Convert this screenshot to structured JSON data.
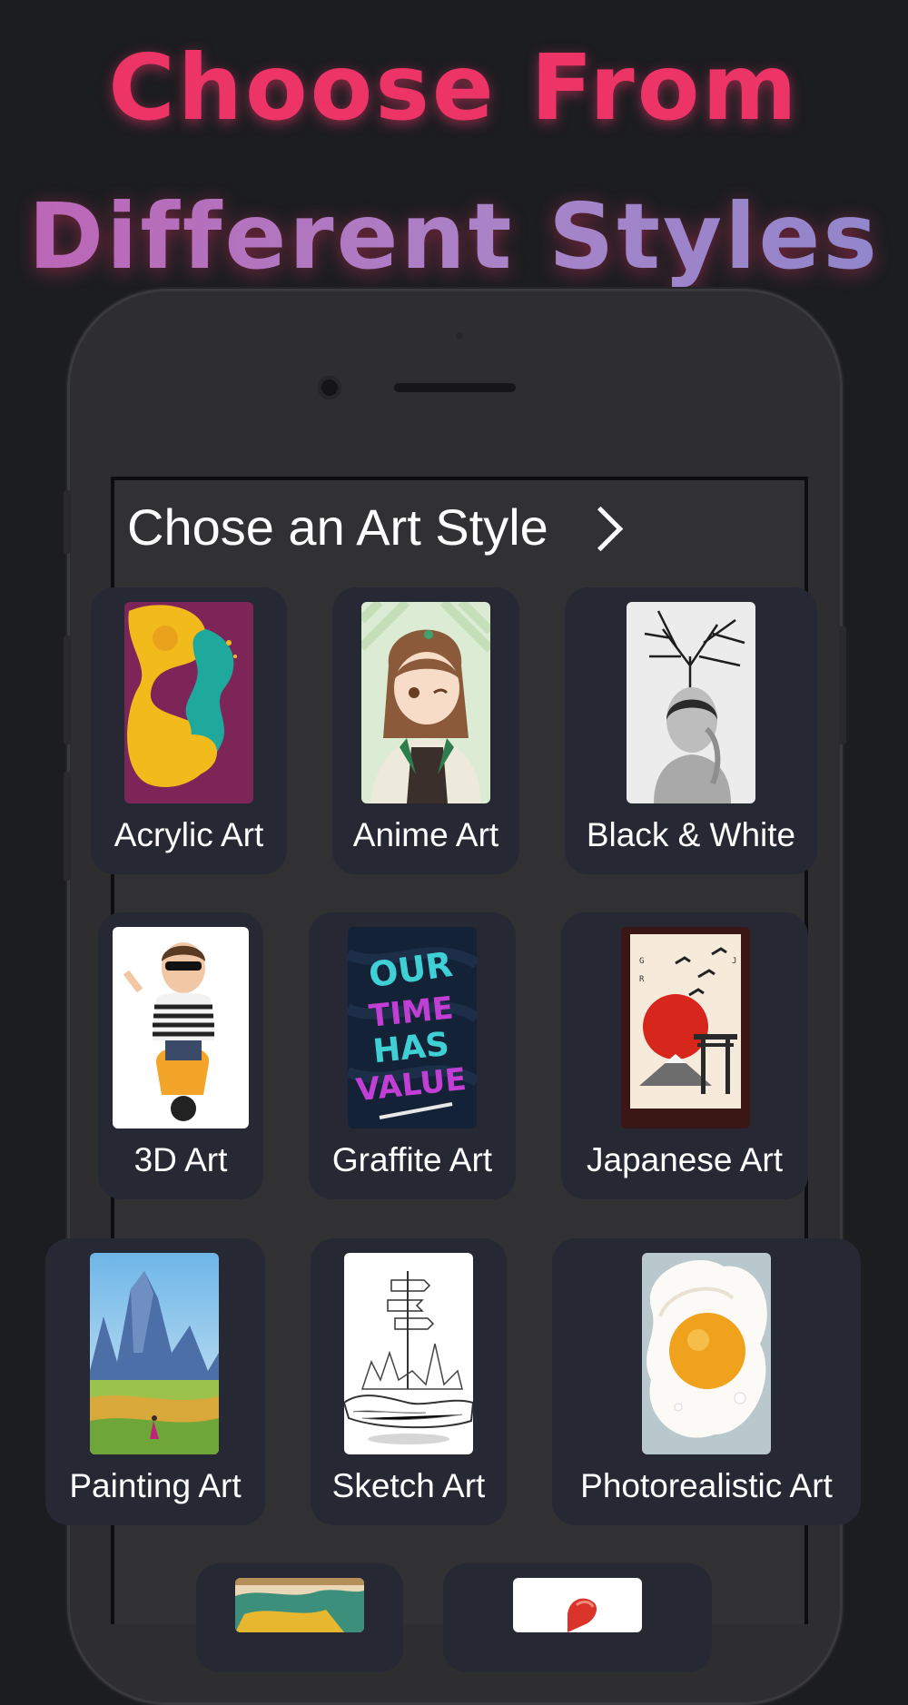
{
  "headline": {
    "line1": "Choose From",
    "line2": "Different Styles"
  },
  "screen": {
    "title": "Chose an Art Style",
    "chevron_icon": "chevron-right-icon"
  },
  "styles": [
    {
      "label": "Acrylic Art"
    },
    {
      "label": "Anime Art"
    },
    {
      "label": "Black & White"
    },
    {
      "label": "3D Art"
    },
    {
      "label": "Graffite Art"
    },
    {
      "label": "Japanese Art"
    },
    {
      "label": "Painting Art"
    },
    {
      "label": "Sketch Art"
    },
    {
      "label": "Photorealistic Art"
    },
    {
      "label": ""
    },
    {
      "label": ""
    }
  ],
  "colors": {
    "background": "#1c1d20",
    "headline_pink": "#ec3467",
    "headline_purple": "#a983c8",
    "card": "#262834",
    "phone_body": "#2e2e30"
  }
}
